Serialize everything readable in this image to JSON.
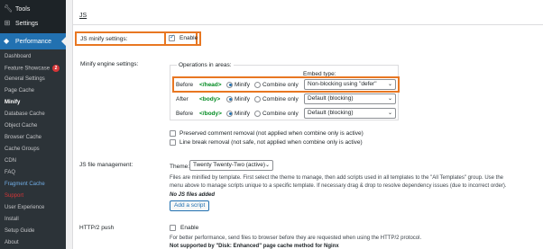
{
  "sidebar": {
    "top_items": [
      {
        "label": "Tools",
        "icon": "wrench-icon"
      },
      {
        "label": "Settings",
        "icon": "settings-icon"
      }
    ],
    "active": {
      "label": "Performance",
      "icon": "performance-icon"
    },
    "submenu": [
      {
        "label": "Dashboard"
      },
      {
        "label": "Feature Showcase",
        "badge": "2"
      },
      {
        "label": "General Settings"
      },
      {
        "label": "Page Cache"
      },
      {
        "label": "Minify"
      },
      {
        "label": "Database Cache"
      },
      {
        "label": "Object Cache"
      },
      {
        "label": "Browser Cache"
      },
      {
        "label": "Cache Groups"
      },
      {
        "label": "CDN"
      },
      {
        "label": "FAQ"
      },
      {
        "label": "Fragment Cache"
      },
      {
        "label": "Support"
      },
      {
        "label": "User Experience"
      },
      {
        "label": "Install"
      },
      {
        "label": "Setup Guide"
      },
      {
        "label": "About"
      }
    ]
  },
  "main": {
    "section_title": "JS",
    "js_minify": {
      "label": "JS minify settings:",
      "checkbox_label": "Enable",
      "checked": true
    },
    "engine": {
      "label": "Minify engine settings:",
      "legend": "Operations in areas:",
      "embed_type_label": "Embed type:",
      "rows": [
        {
          "position": "Before",
          "tag": "</head>",
          "opt1": "Minify",
          "opt2": "Combine only",
          "embed": "Non-blocking using \"defer\""
        },
        {
          "position": "After",
          "tag": "<body>",
          "opt1": "Minify",
          "opt2": "Combine only",
          "embed": "Default (blocking)"
        },
        {
          "position": "Before",
          "tag": "</body>",
          "opt1": "Minify",
          "opt2": "Combine only",
          "embed": "Default (blocking)"
        }
      ],
      "chevron": "⌄"
    },
    "options": [
      {
        "label": "Preserved comment removal (not applied when combine only is active)"
      },
      {
        "label": "Line break removal (not safe, not applied when combine only is active)"
      }
    ],
    "file_management": {
      "label": "JS file management:",
      "theme_label": "Theme:",
      "theme_value": "Twenty Twenty-Two (active)",
      "desc_line1": "Files are minified by template. First select the theme to manage, then add scripts used in all templates to the \"All Templates\" group. Use the",
      "desc_line2": "menu above to manage scripts unique to a specific template. If necessary drag & drop to resolve dependency issues (due to incorrect order).",
      "no_files": "No JS files added",
      "add_button": "Add a script"
    },
    "http2": {
      "label": "HTTP/2 push",
      "checkbox_label": "Enable",
      "desc": "For better performance, send files to browser before they are requested when using the HTTP/2 protocol.",
      "note": "Not supported by \"Disk: Enhanced\" page cache method for Nginx"
    }
  }
}
